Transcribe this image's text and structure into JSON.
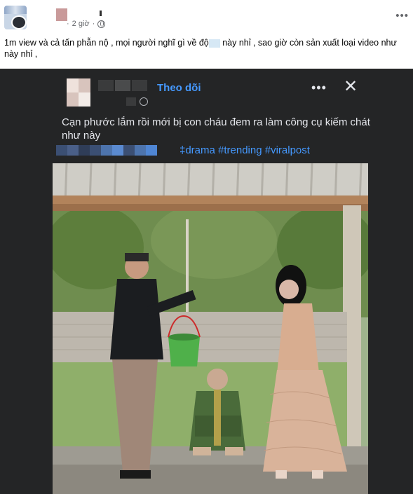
{
  "post": {
    "time": "2 giờ",
    "caption": "1m view và cả tấn phẫn nộ , mọi người nghĩ gì về độ",
    "caption_tail": " này nhỉ , sao giờ còn sản xuất loại video như này nhỉ ,",
    "more_label": "•••"
  },
  "embed": {
    "follow_label": "Theo dõi",
    "more_label": "•••",
    "close_label": "✕",
    "text": "Cạn phước lắm rồi mới bị con cháu đem ra làm công cụ kiếm chát như này",
    "hashtags": "‡drama #trending #viralpost"
  },
  "colors": {
    "link_blue": "#4599ff",
    "embed_bg": "#242526",
    "secondary_text": "#65676b"
  },
  "icons": [
    "globe-icon",
    "more-options-icon",
    "close-icon"
  ]
}
